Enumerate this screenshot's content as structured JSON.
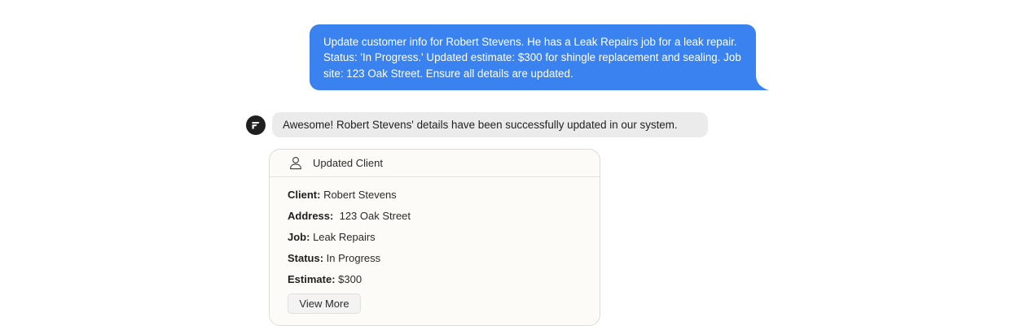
{
  "user_message": {
    "text": "Update customer info for Robert Stevens. He has a Leak Repairs job for a leak repair. Status: 'In Progress.' Updated estimate: $300 for shingle replacement and sealing. Job site: 123 Oak Street. Ensure all details are updated.",
    "bubble_color": "#3a82f0"
  },
  "assistant": {
    "avatar_icon": "assistant-logo-icon",
    "message": "Awesome! Robert Stevens' details have been successfully updated in our system."
  },
  "card": {
    "icon": "person-icon",
    "title": "Updated Client",
    "fields": [
      {
        "label": "Client:",
        "value": " Robert Stevens"
      },
      {
        "label": "Address:",
        "value": "  123 Oak Street"
      },
      {
        "label": "Job:",
        "value": " Leak Repairs"
      },
      {
        "label": "Status:",
        "value": " In Progress"
      },
      {
        "label": "Estimate:",
        "value": " $300"
      }
    ],
    "view_more_label": "View More"
  }
}
